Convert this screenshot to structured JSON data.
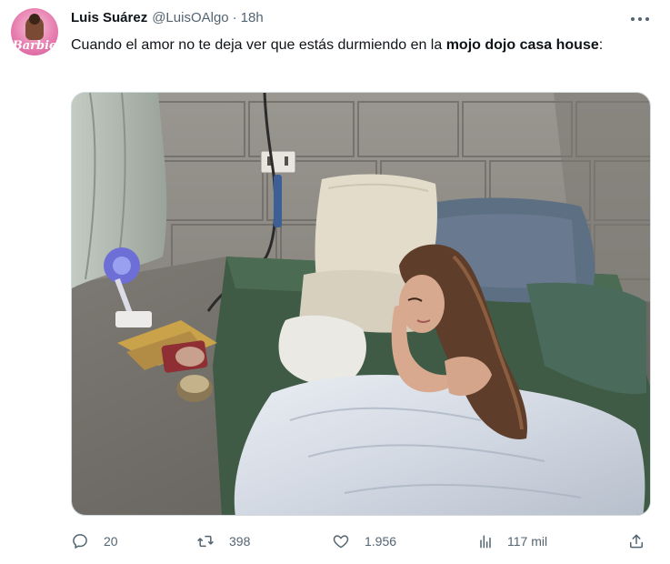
{
  "author": {
    "name": "Luis Suárez",
    "handle": "@LuisOAlgo",
    "separator": "·",
    "time": "18h",
    "avatar_brand": "Barbie"
  },
  "tweet": {
    "text_plain": "Cuando el amor no te deja ver que estás durmiendo en la ",
    "text_bold": "mojo dojo casa house",
    "text_end": ":"
  },
  "actions": {
    "replies": "20",
    "retweets": "398",
    "likes": "1.956",
    "views": "117 mil"
  },
  "icons": {
    "more": "more-horizontal-icon",
    "reply": "reply-icon",
    "retweet": "retweet-icon",
    "like": "heart-icon",
    "views": "views-bar-chart-icon",
    "share": "share-icon"
  }
}
